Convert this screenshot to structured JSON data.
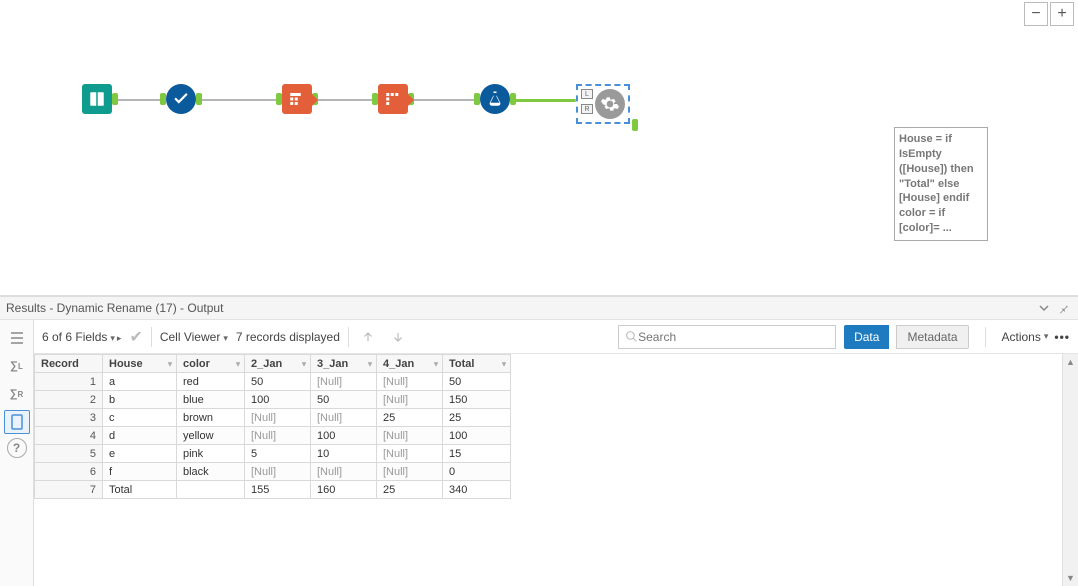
{
  "zoom": {
    "minus": "−",
    "plus": "+"
  },
  "annotation": "House = if IsEmpty ([House]) then \"Total\" else [House] endif color = if [color]= ...",
  "results": {
    "title": "Results - Dynamic Rename (17) - Output",
    "fields_label": "6 of 6 Fields",
    "cellviewer_label": "Cell Viewer",
    "records_label": "7 records displayed",
    "search_placeholder": "Search",
    "data_btn": "Data",
    "meta_btn": "Metadata",
    "actions_label": "Actions"
  },
  "columns": [
    "Record",
    "House",
    "color",
    "2_Jan",
    "3_Jan",
    "4_Jan",
    "Total"
  ],
  "rows": [
    {
      "Record": "1",
      "House": "a",
      "color": "red",
      "2_Jan": "50",
      "3_Jan": "[Null]",
      "4_Jan": "[Null]",
      "Total": "50"
    },
    {
      "Record": "2",
      "House": "b",
      "color": "blue",
      "2_Jan": "100",
      "3_Jan": "50",
      "4_Jan": "[Null]",
      "Total": "150"
    },
    {
      "Record": "3",
      "House": "c",
      "color": "brown",
      "2_Jan": "[Null]",
      "3_Jan": "[Null]",
      "4_Jan": "25",
      "Total": "25"
    },
    {
      "Record": "4",
      "House": "d",
      "color": "yellow",
      "2_Jan": "[Null]",
      "3_Jan": "100",
      "4_Jan": "[Null]",
      "Total": "100"
    },
    {
      "Record": "5",
      "House": "e",
      "color": "pink",
      "2_Jan": "5",
      "3_Jan": "10",
      "4_Jan": "[Null]",
      "Total": "15"
    },
    {
      "Record": "6",
      "House": "f",
      "color": "black",
      "2_Jan": "[Null]",
      "3_Jan": "[Null]",
      "4_Jan": "[Null]",
      "Total": "0"
    },
    {
      "Record": "7",
      "House": "Total",
      "color": "",
      "2_Jan": "155",
      "3_Jan": "160",
      "4_Jan": "25",
      "Total": "340"
    }
  ],
  "left_tabs": {
    "messages": "≡",
    "l": "∑L",
    "r": "∑R",
    "page": "▭",
    "help": "?"
  }
}
